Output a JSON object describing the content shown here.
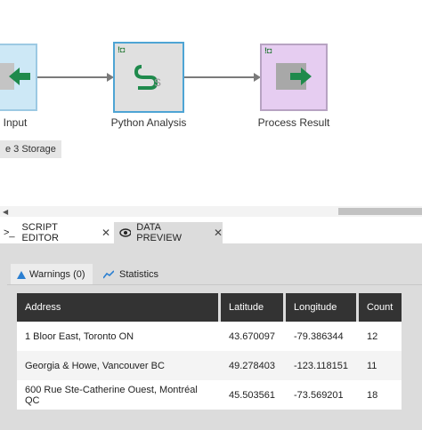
{
  "canvas": {
    "nodes": [
      {
        "label": "Input",
        "color": "#cde8f6",
        "border": "#9cc9e3"
      },
      {
        "label": "Python Analysis",
        "color": "#e0e0e0",
        "border": "#4ea4d4"
      },
      {
        "label": "Process Result",
        "color": "#e6cdf1",
        "border": "#b7a3c2"
      }
    ],
    "tooltip": "e 3 Storage"
  },
  "tabs": [
    {
      "label": "SCRIPT EDITOR",
      "icon": "terminal-icon",
      "active": false
    },
    {
      "label": "DATA PREVIEW",
      "icon": "eye-icon",
      "active": true
    }
  ],
  "subtabs": [
    {
      "label": "Warnings (0)",
      "icon": "warning-triangle-icon",
      "active": true
    },
    {
      "label": "Statistics",
      "icon": "chart-line-icon",
      "active": false
    }
  ],
  "table": {
    "columns": [
      "Address",
      "Latitude",
      "Longitude",
      "Count"
    ],
    "rows": [
      [
        "1 Bloor East, Toronto ON",
        "43.670097",
        "-79.386344",
        "12"
      ],
      [
        "Georgia & Howe, Vancouver BC",
        "49.278403",
        "-123.118151",
        "11"
      ],
      [
        "600 Rue Ste-Catherine Ouest, Montréal QC",
        "45.503561",
        "-73.569201",
        "18"
      ]
    ]
  },
  "colors": {
    "accent": "#1f8a4c",
    "header_bg": "#333333",
    "panel_bg": "#dcdcdc"
  }
}
